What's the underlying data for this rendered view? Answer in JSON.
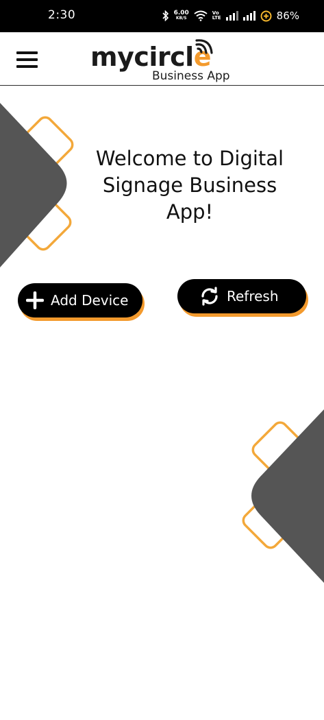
{
  "status_bar": {
    "time": "2:30",
    "net_speed": "6.00",
    "net_speed_unit": "KB/S",
    "volte_top": "Vo",
    "volte_bottom": "LTE",
    "battery": "86%"
  },
  "header": {
    "logo_text_main": "mycircl",
    "logo_text_accent": "e",
    "logo_subtitle": "Business App"
  },
  "main": {
    "welcome": "Welcome to Digital Signage Business App!",
    "add_device_label": "Add Device",
    "refresh_label": "Refresh"
  },
  "colors": {
    "accent": "#f39a2d",
    "dark_shape": "#555555",
    "button_bg": "#000000"
  },
  "icons": [
    "menu-icon",
    "bluetooth-icon",
    "wifi-icon",
    "signal-icon",
    "battery-saver-icon",
    "plus-icon",
    "refresh-icon"
  ]
}
